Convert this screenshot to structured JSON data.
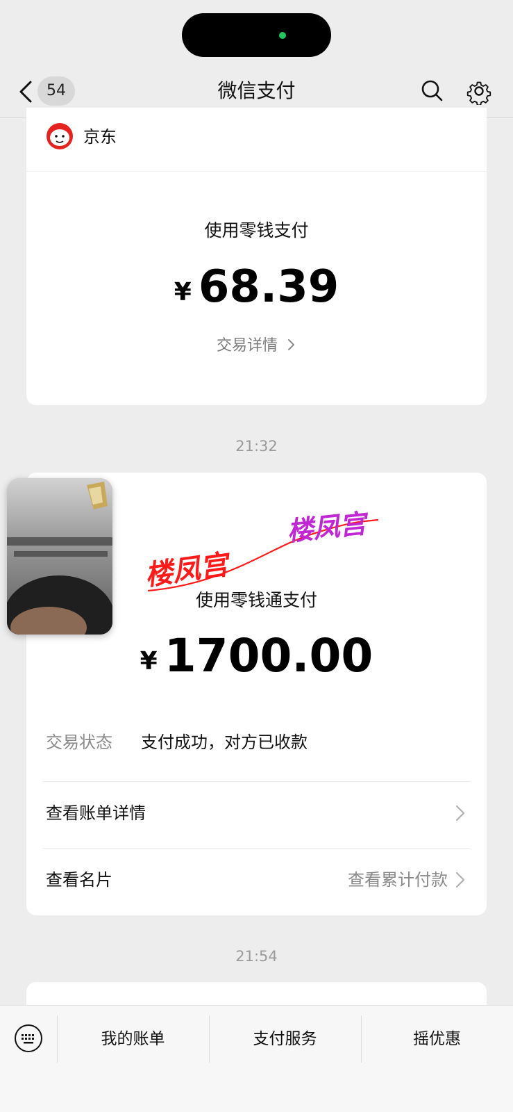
{
  "header": {
    "back_count": "54",
    "title": "微信支付",
    "icons": [
      "back-chevron-icon",
      "search-icon",
      "gear-icon"
    ]
  },
  "card1": {
    "merchant_name": "京东",
    "merchant_logo": "jd-dog-logo",
    "pay_method": "使用零钱支付",
    "currency": "¥",
    "amount": "68.39",
    "detail_link": "交易详情"
  },
  "timestamp1": "21:32",
  "card2": {
    "pay_method": "使用零钱通支付",
    "currency": "¥",
    "amount": "1700.00",
    "status_label": "交易状态",
    "status_value": "支付成功，对方已收款",
    "bill_detail": "查看账单详情",
    "business_card": "查看名片",
    "cumulative": "查看累计付款"
  },
  "watermark": {
    "text1": "楼凤宫",
    "text2": "楼凤宫",
    "color1": "#ff1a1a",
    "color2": "#c026d3"
  },
  "timestamp2": "21:54",
  "bottom_bar": {
    "tabs": [
      "我的账单",
      "支付服务",
      "摇优惠"
    ]
  },
  "colors": {
    "background": "#ededed",
    "card": "#ffffff",
    "status_dot": "#22c55e"
  }
}
